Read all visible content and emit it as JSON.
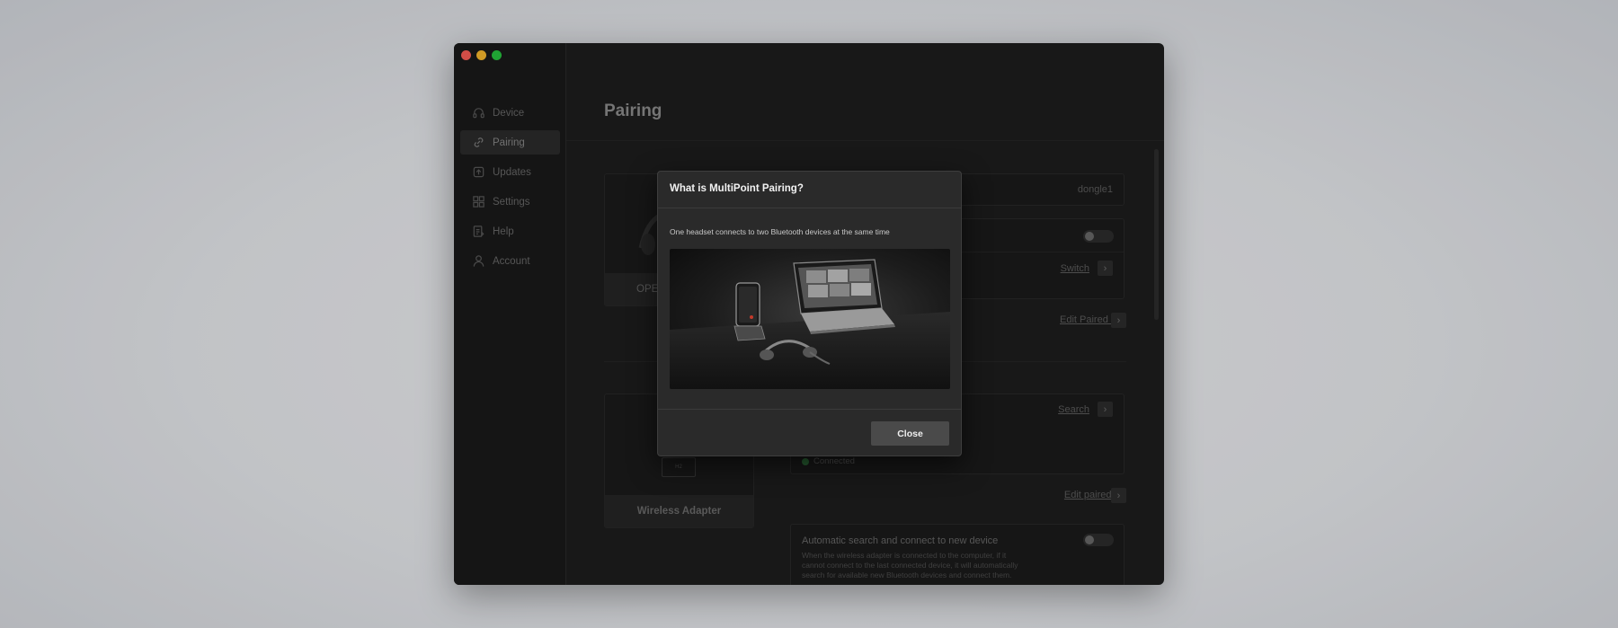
{
  "window": {
    "title": "Pairing",
    "traffic_lights": {
      "close": "#ff5f57",
      "minimize": "#febc2e",
      "zoom": "#28c840"
    }
  },
  "sidebar": {
    "items": [
      {
        "label": "Device",
        "icon": "headset-icon",
        "active": false
      },
      {
        "label": "Pairing",
        "icon": "link-icon",
        "active": true
      },
      {
        "label": "Updates",
        "icon": "update-icon",
        "active": false
      },
      {
        "label": "Settings",
        "icon": "settings-grid-icon",
        "active": false
      },
      {
        "label": "Help",
        "icon": "help-icon",
        "active": false
      },
      {
        "label": "Account",
        "icon": "account-icon",
        "active": false
      }
    ]
  },
  "main": {
    "headset_card_label": "OPE",
    "dongle_value": "dongle1",
    "switch_link": "Switch",
    "edit_paired_list_1": "Edit Paired List",
    "search_link": "Search",
    "connection_status": "Connected",
    "edit_paired_list_2": "Edit paired list",
    "adapter_card_label": "Wireless Adapter",
    "adapter_mini_text": "H2",
    "auto_search": {
      "title": "Automatic search and connect to new device",
      "description": "When the wireless adapter is connected to the computer, if it cannot connect to the last connected device, it will automatically search for available new Bluetooth devices and connect them."
    }
  },
  "modal": {
    "title": "What is MultiPoint Pairing?",
    "description": "One headset connects to two Bluetooth devices at the same time",
    "image_alt": "Smartphone on stand, laptop showing video call, and headset on dark table",
    "close_label": "Close"
  }
}
